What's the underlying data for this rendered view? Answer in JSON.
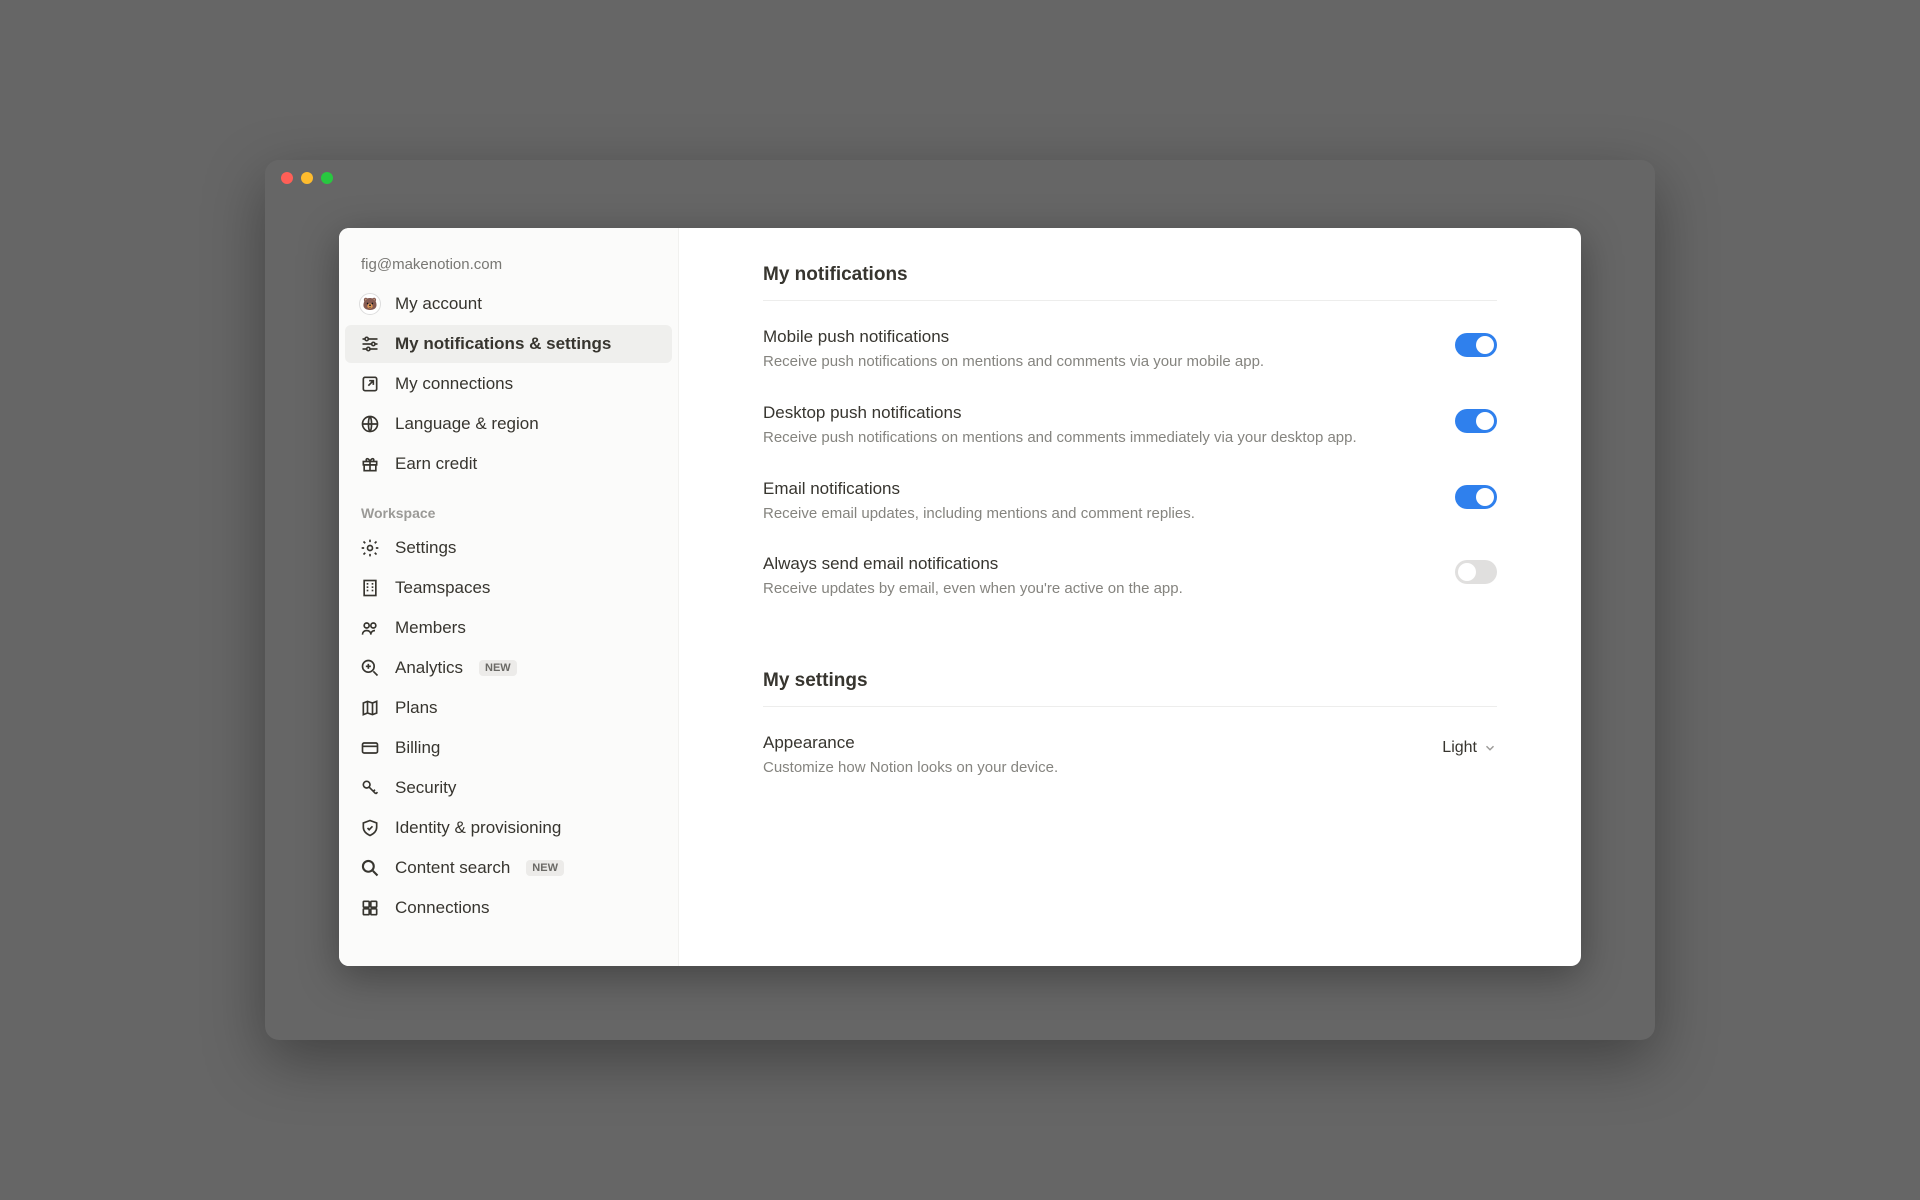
{
  "account_email": "fig@makenotion.com",
  "sidebar": {
    "personal": [
      {
        "id": "my-account",
        "label": "My account"
      },
      {
        "id": "notifications-settings",
        "label": "My notifications & settings"
      },
      {
        "id": "my-connections",
        "label": "My connections"
      },
      {
        "id": "language-region",
        "label": "Language & region"
      },
      {
        "id": "earn-credit",
        "label": "Earn credit"
      }
    ],
    "workspace_header": "Workspace",
    "workspace": [
      {
        "id": "settings",
        "label": "Settings"
      },
      {
        "id": "teamspaces",
        "label": "Teamspaces"
      },
      {
        "id": "members",
        "label": "Members"
      },
      {
        "id": "analytics",
        "label": "Analytics",
        "badge": "NEW"
      },
      {
        "id": "plans",
        "label": "Plans"
      },
      {
        "id": "billing",
        "label": "Billing"
      },
      {
        "id": "security",
        "label": "Security"
      },
      {
        "id": "identity",
        "label": "Identity & provisioning"
      },
      {
        "id": "content-search",
        "label": "Content search",
        "badge": "NEW"
      },
      {
        "id": "connections",
        "label": "Connections"
      }
    ]
  },
  "main": {
    "notifications_title": "My notifications",
    "settings_title": "My settings",
    "rows": {
      "mobile_push": {
        "label": "Mobile push notifications",
        "desc": "Receive push notifications on mentions and comments via your mobile app.",
        "on": true
      },
      "desktop_push": {
        "label": "Desktop push notifications",
        "desc": "Receive push notifications on mentions and comments immediately via your desktop app.",
        "on": true
      },
      "email": {
        "label": "Email notifications",
        "desc": "Receive email updates, including mentions and comment replies.",
        "on": true
      },
      "always_email": {
        "label": "Always send email notifications",
        "desc": "Receive updates by email, even when you're active on the app.",
        "on": false
      },
      "appearance": {
        "label": "Appearance",
        "desc": "Customize how Notion looks on your device.",
        "value": "Light"
      }
    }
  }
}
